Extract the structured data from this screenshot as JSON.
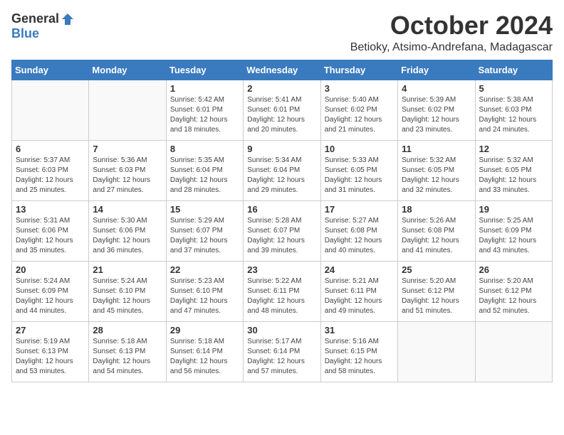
{
  "header": {
    "logo_general": "General",
    "logo_blue": "Blue",
    "month": "October 2024",
    "location": "Betioky, Atsimo-Andrefana, Madagascar"
  },
  "weekdays": [
    "Sunday",
    "Monday",
    "Tuesday",
    "Wednesday",
    "Thursday",
    "Friday",
    "Saturday"
  ],
  "weeks": [
    [
      {
        "day": "",
        "sunrise": "",
        "sunset": "",
        "daylight": ""
      },
      {
        "day": "",
        "sunrise": "",
        "sunset": "",
        "daylight": ""
      },
      {
        "day": "1",
        "sunrise": "Sunrise: 5:42 AM",
        "sunset": "Sunset: 6:01 PM",
        "daylight": "Daylight: 12 hours and 18 minutes."
      },
      {
        "day": "2",
        "sunrise": "Sunrise: 5:41 AM",
        "sunset": "Sunset: 6:01 PM",
        "daylight": "Daylight: 12 hours and 20 minutes."
      },
      {
        "day": "3",
        "sunrise": "Sunrise: 5:40 AM",
        "sunset": "Sunset: 6:02 PM",
        "daylight": "Daylight: 12 hours and 21 minutes."
      },
      {
        "day": "4",
        "sunrise": "Sunrise: 5:39 AM",
        "sunset": "Sunset: 6:02 PM",
        "daylight": "Daylight: 12 hours and 23 minutes."
      },
      {
        "day": "5",
        "sunrise": "Sunrise: 5:38 AM",
        "sunset": "Sunset: 6:03 PM",
        "daylight": "Daylight: 12 hours and 24 minutes."
      }
    ],
    [
      {
        "day": "6",
        "sunrise": "Sunrise: 5:37 AM",
        "sunset": "Sunset: 6:03 PM",
        "daylight": "Daylight: 12 hours and 25 minutes."
      },
      {
        "day": "7",
        "sunrise": "Sunrise: 5:36 AM",
        "sunset": "Sunset: 6:03 PM",
        "daylight": "Daylight: 12 hours and 27 minutes."
      },
      {
        "day": "8",
        "sunrise": "Sunrise: 5:35 AM",
        "sunset": "Sunset: 6:04 PM",
        "daylight": "Daylight: 12 hours and 28 minutes."
      },
      {
        "day": "9",
        "sunrise": "Sunrise: 5:34 AM",
        "sunset": "Sunset: 6:04 PM",
        "daylight": "Daylight: 12 hours and 29 minutes."
      },
      {
        "day": "10",
        "sunrise": "Sunrise: 5:33 AM",
        "sunset": "Sunset: 6:05 PM",
        "daylight": "Daylight: 12 hours and 31 minutes."
      },
      {
        "day": "11",
        "sunrise": "Sunrise: 5:32 AM",
        "sunset": "Sunset: 6:05 PM",
        "daylight": "Daylight: 12 hours and 32 minutes."
      },
      {
        "day": "12",
        "sunrise": "Sunrise: 5:32 AM",
        "sunset": "Sunset: 6:05 PM",
        "daylight": "Daylight: 12 hours and 33 minutes."
      }
    ],
    [
      {
        "day": "13",
        "sunrise": "Sunrise: 5:31 AM",
        "sunset": "Sunset: 6:06 PM",
        "daylight": "Daylight: 12 hours and 35 minutes."
      },
      {
        "day": "14",
        "sunrise": "Sunrise: 5:30 AM",
        "sunset": "Sunset: 6:06 PM",
        "daylight": "Daylight: 12 hours and 36 minutes."
      },
      {
        "day": "15",
        "sunrise": "Sunrise: 5:29 AM",
        "sunset": "Sunset: 6:07 PM",
        "daylight": "Daylight: 12 hours and 37 minutes."
      },
      {
        "day": "16",
        "sunrise": "Sunrise: 5:28 AM",
        "sunset": "Sunset: 6:07 PM",
        "daylight": "Daylight: 12 hours and 39 minutes."
      },
      {
        "day": "17",
        "sunrise": "Sunrise: 5:27 AM",
        "sunset": "Sunset: 6:08 PM",
        "daylight": "Daylight: 12 hours and 40 minutes."
      },
      {
        "day": "18",
        "sunrise": "Sunrise: 5:26 AM",
        "sunset": "Sunset: 6:08 PM",
        "daylight": "Daylight: 12 hours and 41 minutes."
      },
      {
        "day": "19",
        "sunrise": "Sunrise: 5:25 AM",
        "sunset": "Sunset: 6:09 PM",
        "daylight": "Daylight: 12 hours and 43 minutes."
      }
    ],
    [
      {
        "day": "20",
        "sunrise": "Sunrise: 5:24 AM",
        "sunset": "Sunset: 6:09 PM",
        "daylight": "Daylight: 12 hours and 44 minutes."
      },
      {
        "day": "21",
        "sunrise": "Sunrise: 5:24 AM",
        "sunset": "Sunset: 6:10 PM",
        "daylight": "Daylight: 12 hours and 45 minutes."
      },
      {
        "day": "22",
        "sunrise": "Sunrise: 5:23 AM",
        "sunset": "Sunset: 6:10 PM",
        "daylight": "Daylight: 12 hours and 47 minutes."
      },
      {
        "day": "23",
        "sunrise": "Sunrise: 5:22 AM",
        "sunset": "Sunset: 6:11 PM",
        "daylight": "Daylight: 12 hours and 48 minutes."
      },
      {
        "day": "24",
        "sunrise": "Sunrise: 5:21 AM",
        "sunset": "Sunset: 6:11 PM",
        "daylight": "Daylight: 12 hours and 49 minutes."
      },
      {
        "day": "25",
        "sunrise": "Sunrise: 5:20 AM",
        "sunset": "Sunset: 6:12 PM",
        "daylight": "Daylight: 12 hours and 51 minutes."
      },
      {
        "day": "26",
        "sunrise": "Sunrise: 5:20 AM",
        "sunset": "Sunset: 6:12 PM",
        "daylight": "Daylight: 12 hours and 52 minutes."
      }
    ],
    [
      {
        "day": "27",
        "sunrise": "Sunrise: 5:19 AM",
        "sunset": "Sunset: 6:13 PM",
        "daylight": "Daylight: 12 hours and 53 minutes."
      },
      {
        "day": "28",
        "sunrise": "Sunrise: 5:18 AM",
        "sunset": "Sunset: 6:13 PM",
        "daylight": "Daylight: 12 hours and 54 minutes."
      },
      {
        "day": "29",
        "sunrise": "Sunrise: 5:18 AM",
        "sunset": "Sunset: 6:14 PM",
        "daylight": "Daylight: 12 hours and 56 minutes."
      },
      {
        "day": "30",
        "sunrise": "Sunrise: 5:17 AM",
        "sunset": "Sunset: 6:14 PM",
        "daylight": "Daylight: 12 hours and 57 minutes."
      },
      {
        "day": "31",
        "sunrise": "Sunrise: 5:16 AM",
        "sunset": "Sunset: 6:15 PM",
        "daylight": "Daylight: 12 hours and 58 minutes."
      },
      {
        "day": "",
        "sunrise": "",
        "sunset": "",
        "daylight": ""
      },
      {
        "day": "",
        "sunrise": "",
        "sunset": "",
        "daylight": ""
      }
    ]
  ]
}
